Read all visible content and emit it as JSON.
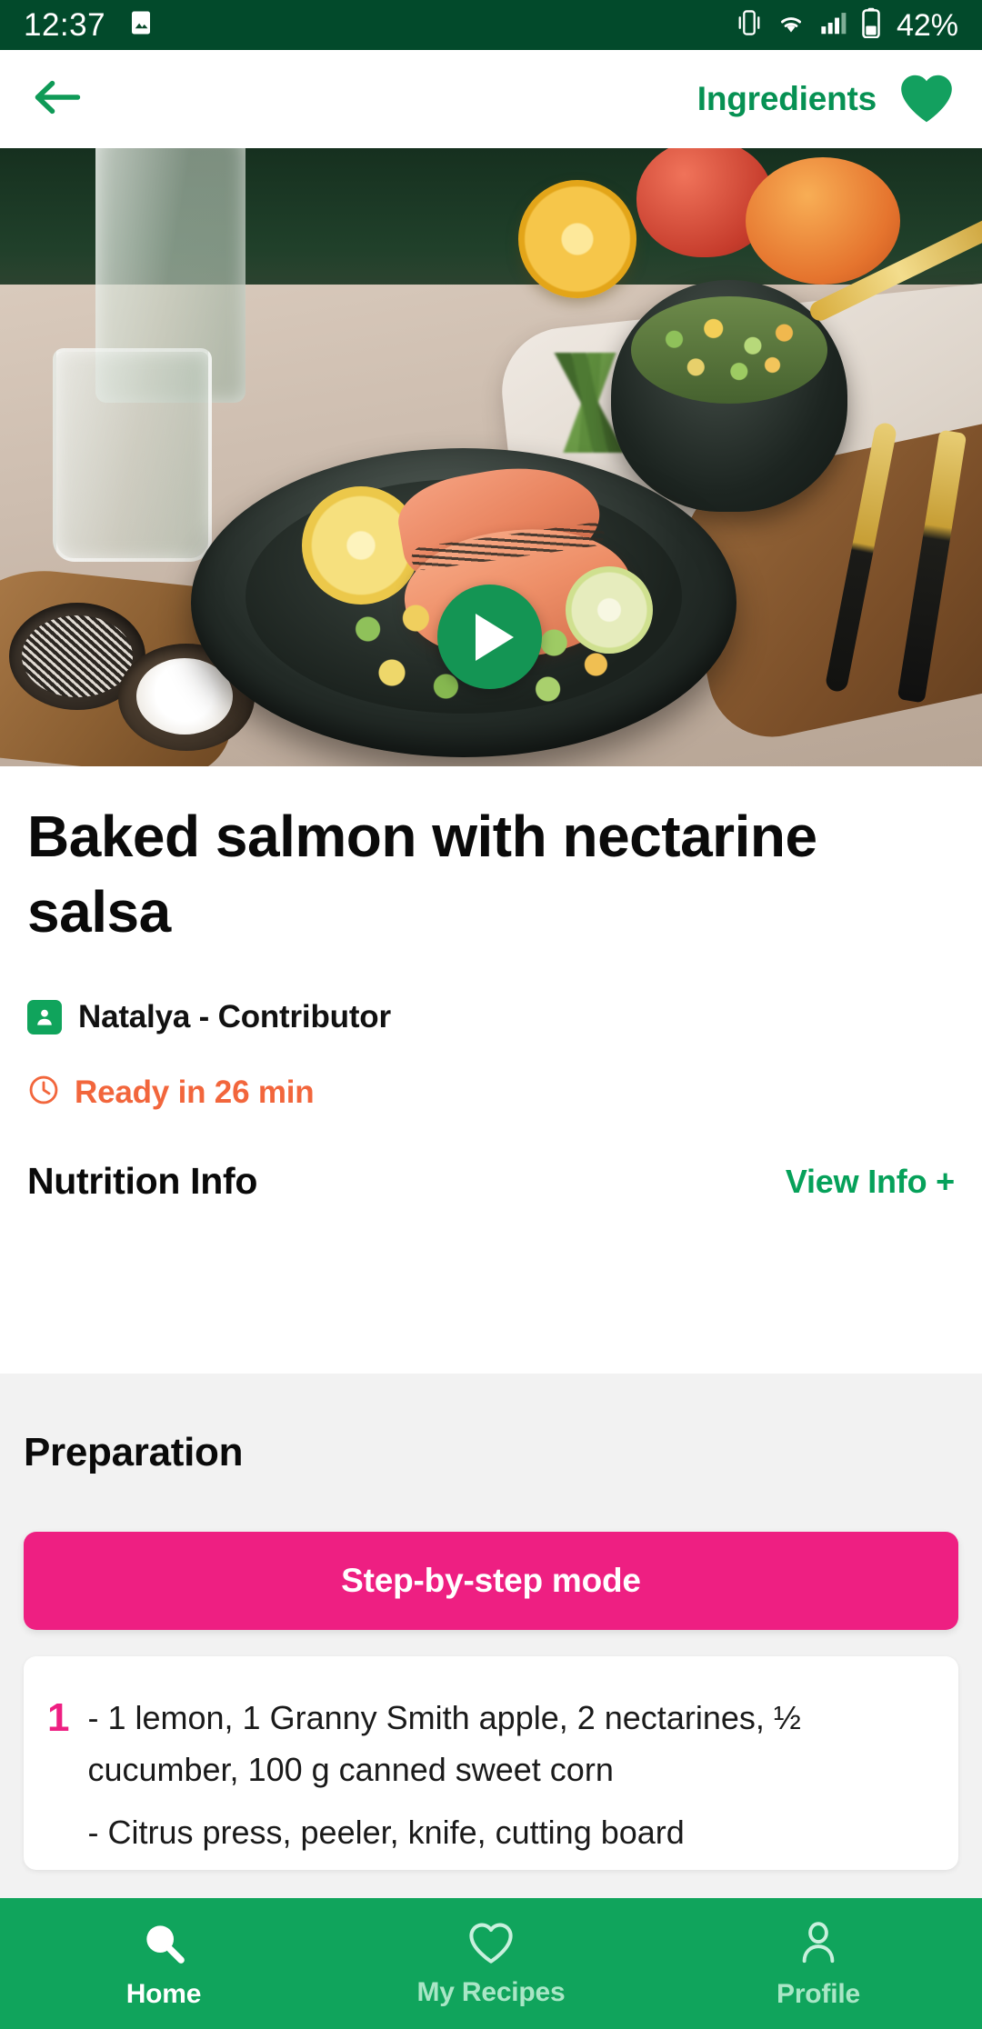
{
  "status_bar": {
    "time": "12:37",
    "battery_percent": "42%",
    "icons": [
      "image-icon",
      "vibrate-icon",
      "wifi-icon",
      "signal-icon",
      "battery-icon"
    ]
  },
  "app_bar": {
    "back_icon": "back-arrow-icon",
    "title": "Ingredients",
    "favorite_icon": "heart-filled-icon",
    "accent_color": "#069153"
  },
  "hero": {
    "play_icon": "play-icon",
    "play_button_color": "#149554",
    "alt": "Baked salmon fillets on a dark plate with nectarine salsa"
  },
  "recipe": {
    "title": "Baked salmon with nectarine salsa",
    "contributor_icon": "person-badge-icon",
    "contributor": "Natalya - Contributor",
    "time_icon": "clock-icon",
    "ready_in": "Ready in 26 min",
    "time_color": "#f2663c",
    "nutrition_label": "Nutrition Info",
    "nutrition_link": "View Info +",
    "link_color": "#06a15a"
  },
  "preparation": {
    "heading": "Preparation",
    "step_mode_button": "Step-by-step mode",
    "button_color": "#ee1f82",
    "steps": [
      {
        "number": "1",
        "lines": [
          "- 1 lemon, 1 Granny Smith apple, 2 nectarines, ½ cucumber, 100 g canned sweet corn",
          "- Citrus press, peeler, knife, cutting board"
        ]
      }
    ]
  },
  "bottom_nav": {
    "background_color": "#10a45c",
    "items": [
      {
        "label": "Home",
        "icon": "search-icon",
        "active": true
      },
      {
        "label": "My Recipes",
        "icon": "heart-outline-icon",
        "active": false
      },
      {
        "label": "Profile",
        "icon": "person-outline-icon",
        "active": false
      }
    ]
  }
}
